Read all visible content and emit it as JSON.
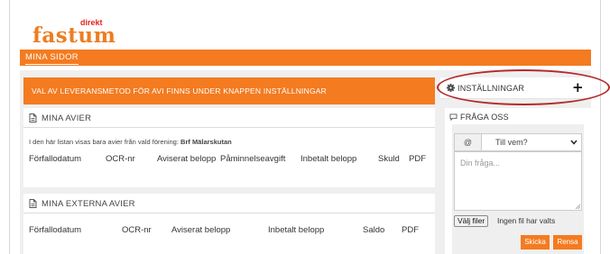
{
  "brand": {
    "name": "fastum",
    "superscript": "direkt"
  },
  "topnav": {
    "items": [
      {
        "label": "MINA SIDOR"
      }
    ]
  },
  "banner": {
    "text": "VAL AV LEVERANSMETOD FÖR AVI FINNS UNDER KNAPPEN INSTÄLLNINGAR"
  },
  "avier": {
    "title": "MINA AVIER",
    "info_text": "I den här listan visas bara avier från vald förening:",
    "association": "Brf Mälarskutan",
    "columns": [
      "Förfallodatum",
      "OCR-nr",
      "Aviserat belopp",
      "Påminnelseavgift",
      "Inbetalt belopp",
      "Skuld",
      "PDF"
    ]
  },
  "external_avier": {
    "title": "MINA EXTERNA AVIER",
    "columns": [
      "Förfallodatum",
      "OCR-nr",
      "Aviserat belopp",
      "Inbetalt belopp",
      "Saldo",
      "PDF"
    ]
  },
  "settings": {
    "label": "INSTÄLLNINGAR",
    "expand_icon": "plus-icon"
  },
  "ask": {
    "title": "FRÅGA OSS",
    "to_addon": "@",
    "to_value": "Till vem?",
    "question_placeholder": "Din fråga...",
    "file_button": "Välj filer",
    "file_status": "Ingen fil har valts",
    "send_label": "Skicka",
    "clear_label": "Rensa"
  },
  "colors": {
    "accent": "#f47b20",
    "annotation": "#b52a2a"
  }
}
